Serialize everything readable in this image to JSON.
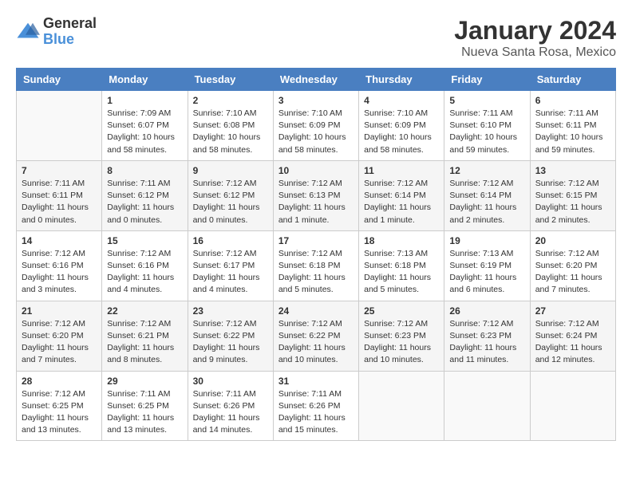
{
  "logo": {
    "general": "General",
    "blue": "Blue"
  },
  "header": {
    "month": "January 2024",
    "location": "Nueva Santa Rosa, Mexico"
  },
  "weekdays": [
    "Sunday",
    "Monday",
    "Tuesday",
    "Wednesday",
    "Thursday",
    "Friday",
    "Saturday"
  ],
  "weeks": [
    [
      {
        "day": "",
        "info": ""
      },
      {
        "day": "1",
        "info": "Sunrise: 7:09 AM\nSunset: 6:07 PM\nDaylight: 10 hours\nand 58 minutes."
      },
      {
        "day": "2",
        "info": "Sunrise: 7:10 AM\nSunset: 6:08 PM\nDaylight: 10 hours\nand 58 minutes."
      },
      {
        "day": "3",
        "info": "Sunrise: 7:10 AM\nSunset: 6:09 PM\nDaylight: 10 hours\nand 58 minutes."
      },
      {
        "day": "4",
        "info": "Sunrise: 7:10 AM\nSunset: 6:09 PM\nDaylight: 10 hours\nand 58 minutes."
      },
      {
        "day": "5",
        "info": "Sunrise: 7:11 AM\nSunset: 6:10 PM\nDaylight: 10 hours\nand 59 minutes."
      },
      {
        "day": "6",
        "info": "Sunrise: 7:11 AM\nSunset: 6:11 PM\nDaylight: 10 hours\nand 59 minutes."
      }
    ],
    [
      {
        "day": "7",
        "info": "Sunrise: 7:11 AM\nSunset: 6:11 PM\nDaylight: 11 hours\nand 0 minutes."
      },
      {
        "day": "8",
        "info": "Sunrise: 7:11 AM\nSunset: 6:12 PM\nDaylight: 11 hours\nand 0 minutes."
      },
      {
        "day": "9",
        "info": "Sunrise: 7:12 AM\nSunset: 6:12 PM\nDaylight: 11 hours\nand 0 minutes."
      },
      {
        "day": "10",
        "info": "Sunrise: 7:12 AM\nSunset: 6:13 PM\nDaylight: 11 hours\nand 1 minute."
      },
      {
        "day": "11",
        "info": "Sunrise: 7:12 AM\nSunset: 6:14 PM\nDaylight: 11 hours\nand 1 minute."
      },
      {
        "day": "12",
        "info": "Sunrise: 7:12 AM\nSunset: 6:14 PM\nDaylight: 11 hours\nand 2 minutes."
      },
      {
        "day": "13",
        "info": "Sunrise: 7:12 AM\nSunset: 6:15 PM\nDaylight: 11 hours\nand 2 minutes."
      }
    ],
    [
      {
        "day": "14",
        "info": "Sunrise: 7:12 AM\nSunset: 6:16 PM\nDaylight: 11 hours\nand 3 minutes."
      },
      {
        "day": "15",
        "info": "Sunrise: 7:12 AM\nSunset: 6:16 PM\nDaylight: 11 hours\nand 4 minutes."
      },
      {
        "day": "16",
        "info": "Sunrise: 7:12 AM\nSunset: 6:17 PM\nDaylight: 11 hours\nand 4 minutes."
      },
      {
        "day": "17",
        "info": "Sunrise: 7:12 AM\nSunset: 6:18 PM\nDaylight: 11 hours\nand 5 minutes."
      },
      {
        "day": "18",
        "info": "Sunrise: 7:13 AM\nSunset: 6:18 PM\nDaylight: 11 hours\nand 5 minutes."
      },
      {
        "day": "19",
        "info": "Sunrise: 7:13 AM\nSunset: 6:19 PM\nDaylight: 11 hours\nand 6 minutes."
      },
      {
        "day": "20",
        "info": "Sunrise: 7:12 AM\nSunset: 6:20 PM\nDaylight: 11 hours\nand 7 minutes."
      }
    ],
    [
      {
        "day": "21",
        "info": "Sunrise: 7:12 AM\nSunset: 6:20 PM\nDaylight: 11 hours\nand 7 minutes."
      },
      {
        "day": "22",
        "info": "Sunrise: 7:12 AM\nSunset: 6:21 PM\nDaylight: 11 hours\nand 8 minutes."
      },
      {
        "day": "23",
        "info": "Sunrise: 7:12 AM\nSunset: 6:22 PM\nDaylight: 11 hours\nand 9 minutes."
      },
      {
        "day": "24",
        "info": "Sunrise: 7:12 AM\nSunset: 6:22 PM\nDaylight: 11 hours\nand 10 minutes."
      },
      {
        "day": "25",
        "info": "Sunrise: 7:12 AM\nSunset: 6:23 PM\nDaylight: 11 hours\nand 10 minutes."
      },
      {
        "day": "26",
        "info": "Sunrise: 7:12 AM\nSunset: 6:23 PM\nDaylight: 11 hours\nand 11 minutes."
      },
      {
        "day": "27",
        "info": "Sunrise: 7:12 AM\nSunset: 6:24 PM\nDaylight: 11 hours\nand 12 minutes."
      }
    ],
    [
      {
        "day": "28",
        "info": "Sunrise: 7:12 AM\nSunset: 6:25 PM\nDaylight: 11 hours\nand 13 minutes."
      },
      {
        "day": "29",
        "info": "Sunrise: 7:11 AM\nSunset: 6:25 PM\nDaylight: 11 hours\nand 13 minutes."
      },
      {
        "day": "30",
        "info": "Sunrise: 7:11 AM\nSunset: 6:26 PM\nDaylight: 11 hours\nand 14 minutes."
      },
      {
        "day": "31",
        "info": "Sunrise: 7:11 AM\nSunset: 6:26 PM\nDaylight: 11 hours\nand 15 minutes."
      },
      {
        "day": "",
        "info": ""
      },
      {
        "day": "",
        "info": ""
      },
      {
        "day": "",
        "info": ""
      }
    ]
  ]
}
